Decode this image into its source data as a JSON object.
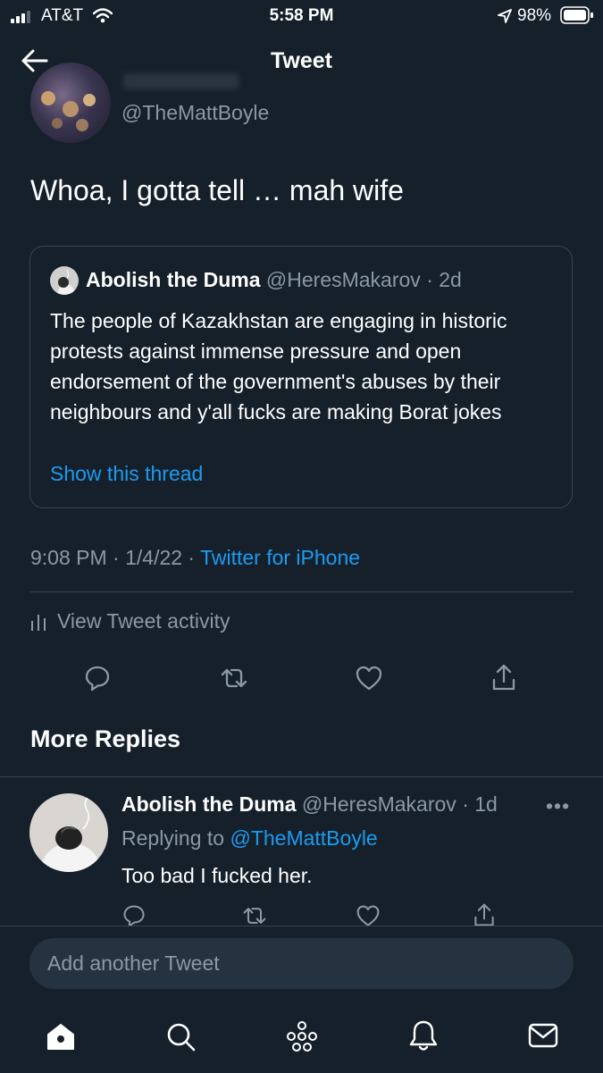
{
  "status_bar": {
    "carrier": "AT&T",
    "time": "5:58 PM",
    "battery": "98%"
  },
  "header": {
    "title": "Tweet"
  },
  "tweet": {
    "handle": "@TheMattBoyle",
    "text": "Whoa, I gotta tell … mah wife",
    "quote": {
      "name": "Abolish the Duma",
      "handle": "@HeresMakarov",
      "age": "· 2d",
      "text": "The people of Kazakhstan are engaging in historic protests against immense pressure and open endorsement of the government's abuses by their neighbours and y'all fucks are making Borat jokes",
      "thread_link": "Show this thread"
    },
    "timestamp": "9:08 PM · 1/4/22 ·",
    "source": "Twitter for iPhone",
    "activity_label": "View Tweet activity"
  },
  "more_replies": {
    "title": "More Replies",
    "reply": {
      "name": "Abolish the Duma",
      "handle": "@HeresMakarov",
      "age": "· 1d",
      "replying_prefix": "Replying to",
      "replying_handle": "@TheMattBoyle",
      "text": "Too bad I fucked her."
    }
  },
  "compose": {
    "placeholder": "Add another Tweet"
  },
  "icons": {
    "actions": [
      "reply-icon",
      "retweet-icon",
      "like-icon",
      "share-icon"
    ],
    "tabs": [
      "home-icon",
      "search-icon",
      "spaces-icon",
      "notifications-icon",
      "messages-icon"
    ]
  },
  "colors": {
    "background": "#15202b",
    "accent": "#1d9bf0",
    "muted": "#8b98a5",
    "border": "#38444d"
  }
}
